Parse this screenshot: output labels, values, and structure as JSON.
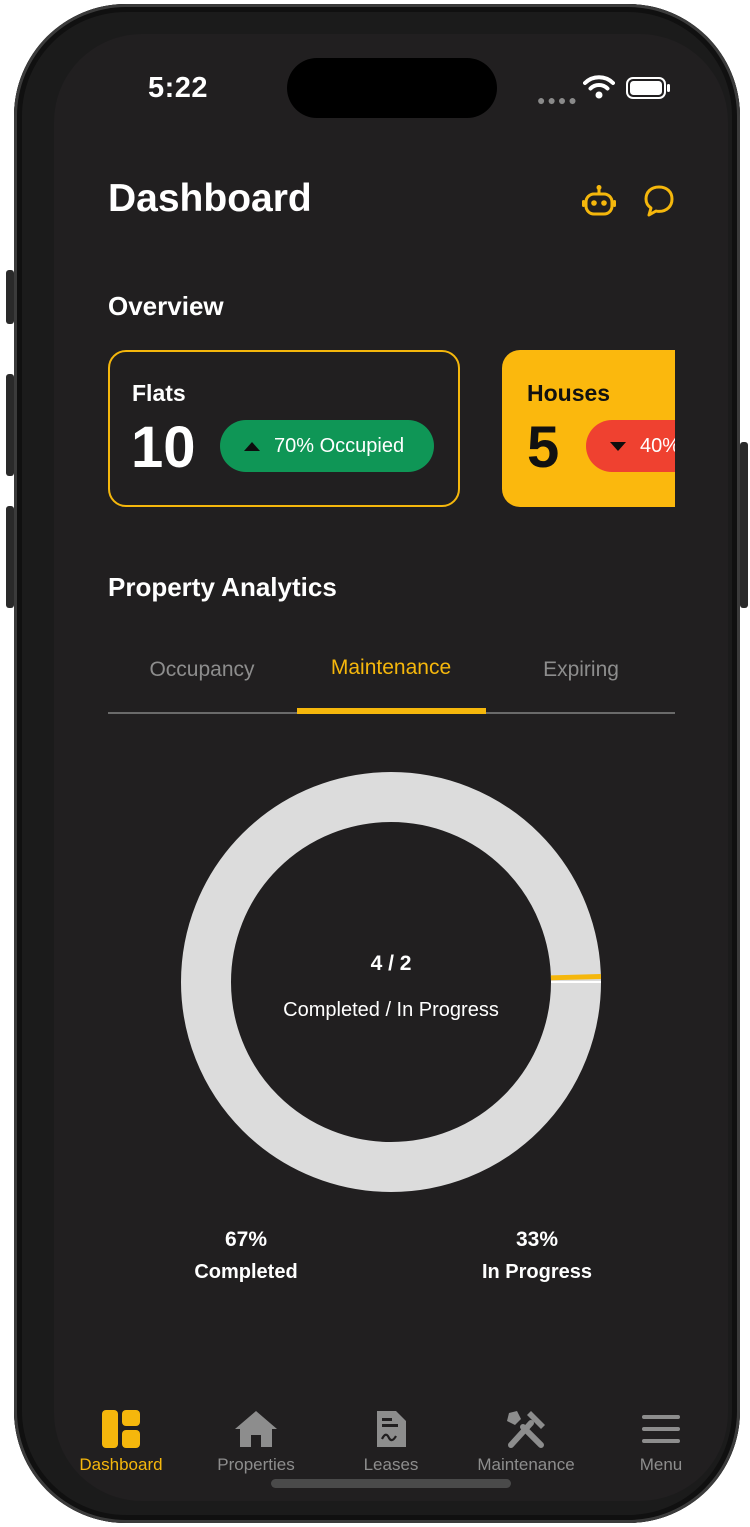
{
  "status_bar": {
    "time": "5:22"
  },
  "header": {
    "title": "Dashboard",
    "icons": [
      "robot-icon",
      "chat-icon"
    ]
  },
  "overview": {
    "title": "Overview",
    "cards": [
      {
        "label": "Flats",
        "value": "10",
        "badge": "70% Occupied",
        "trend": "up"
      },
      {
        "label": "Houses",
        "value": "5",
        "badge": "40%",
        "trend": "down"
      }
    ]
  },
  "analytics": {
    "title": "Property Analytics",
    "tabs": [
      "Occupancy",
      "Maintenance",
      "Expiring"
    ],
    "active_tab": "Maintenance"
  },
  "chart_data": {
    "type": "pie",
    "categories": [
      "Completed",
      "In Progress"
    ],
    "values": [
      4,
      2
    ],
    "center_value": "4 / 2",
    "center_label": "Completed / In Progress",
    "legend": [
      {
        "percent": "67%",
        "label": "Completed"
      },
      {
        "percent": "33%",
        "label": "In Progress"
      }
    ]
  },
  "tab_bar": {
    "items": [
      {
        "label": "Dashboard",
        "icon": "dashboard-icon"
      },
      {
        "label": "Properties",
        "icon": "home-icon"
      },
      {
        "label": "Leases",
        "icon": "document-icon"
      },
      {
        "label": "Maintenance",
        "icon": "tools-icon"
      },
      {
        "label": "Menu",
        "icon": "menu-icon"
      }
    ],
    "active": "Dashboard"
  },
  "colors": {
    "background": "#211f20",
    "accent": "#f5b70c",
    "up": "#0f9656",
    "down": "#ef4130",
    "donut_ring": "#dcdcdc",
    "muted": "#8d8d8d"
  }
}
